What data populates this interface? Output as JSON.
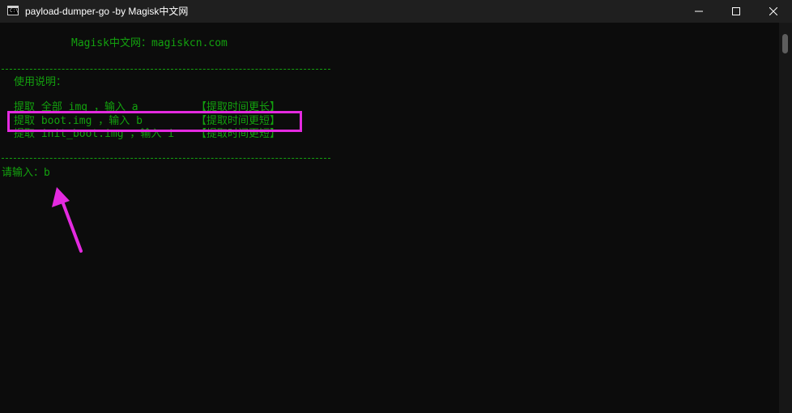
{
  "window": {
    "title": "payload-dumper-go -by Magisk中文网",
    "icon": "console-icon",
    "controls": [
      "minimize-icon",
      "maximize-icon",
      "close-icon"
    ]
  },
  "console": {
    "site_line": "Magisk中文网：magiskcn.com",
    "separator": "------------------------------------------------",
    "usage_heading": "使用说明：",
    "options": [
      {
        "label": "提取 全部 img ，输入 a",
        "note": "【提取时间更长】"
      },
      {
        "label": "提取 boot.img ，输入 b",
        "note": "【提取时间更短】"
      },
      {
        "label": "提取 init_boot.img ，输入 i",
        "note": "【提取时间更短】"
      }
    ],
    "prompt": "请输入：",
    "user_input": "b"
  },
  "annotation": {
    "box_color": "#e42ae0",
    "arrow_color": "#e42ae0"
  },
  "colors": {
    "console_bg": "#0c0c0c",
    "console_text": "#13a10e",
    "titlebar_bg": "#1f1f1f"
  }
}
